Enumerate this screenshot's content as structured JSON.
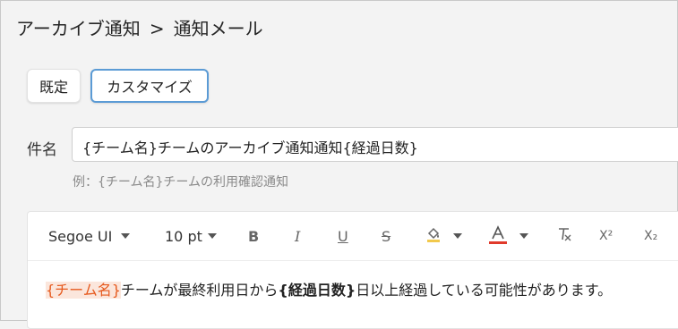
{
  "breadcrumb": {
    "parent": "アーカイブ通知",
    "separator": ">",
    "current": "通知メール"
  },
  "buttons": {
    "default_label": "既定",
    "customize_label": "カスタマイズ"
  },
  "subject": {
    "label": "件名",
    "value": "{チーム名}チームのアーカイブ通知通知{経過日数}",
    "hint": "例：{チーム名}チームの利用確認通知"
  },
  "toolbar": {
    "font_name": "Segoe UI",
    "font_size": "10 pt",
    "bold": "B",
    "italic": "I",
    "underline": "U",
    "strike": "S",
    "superscript": "X²",
    "subscript": "X₂",
    "font_color_accent": "#e03a2b"
  },
  "body": {
    "team_var": "{チーム名}",
    "text1": "チームが最終利用日から",
    "days_var": "{経過日数}",
    "text2": "日以上経過している可能性があります。"
  },
  "colors": {
    "accent": "#5b9bd5",
    "variable": "#e65a1e"
  }
}
